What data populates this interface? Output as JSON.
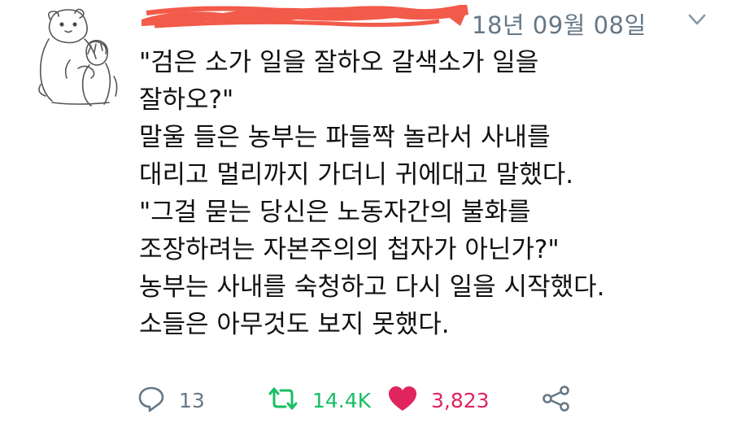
{
  "tweet": {
    "author": {
      "avatar_icon": "bear-and-boy-sketch-avatar",
      "name_redaction_color": "#f25a4a"
    },
    "timestamp": "18년 09월 08일",
    "menu_icon": "chevron-down-icon",
    "lines": [
      "\"검은 소가 일을 잘하오 갈색소가 일을",
      "잘하오?\"",
      "말울 들은 농부는 파들짝 놀라서 사내를",
      "대리고 멀리까지 가더니 귀에대고 말했다.",
      "\"그걸 묻는 당신은 노동자간의 불화를",
      "조장하려는 자본주의의 첩자가 아닌가?\"",
      "농부는 사내를 숙청하고 다시 일을 시작했다.",
      "소들은 아무것도 보지 못했다."
    ],
    "actions": {
      "reply": {
        "icon": "reply-bubble-icon",
        "count": "13",
        "color": "#657786"
      },
      "retweet": {
        "icon": "retweet-icon",
        "count": "14.4K",
        "color": "#17bf63"
      },
      "like": {
        "icon": "heart-icon",
        "count": "3,823",
        "color": "#e0245e"
      },
      "share": {
        "icon": "share-icon",
        "color": "#657786"
      }
    }
  }
}
